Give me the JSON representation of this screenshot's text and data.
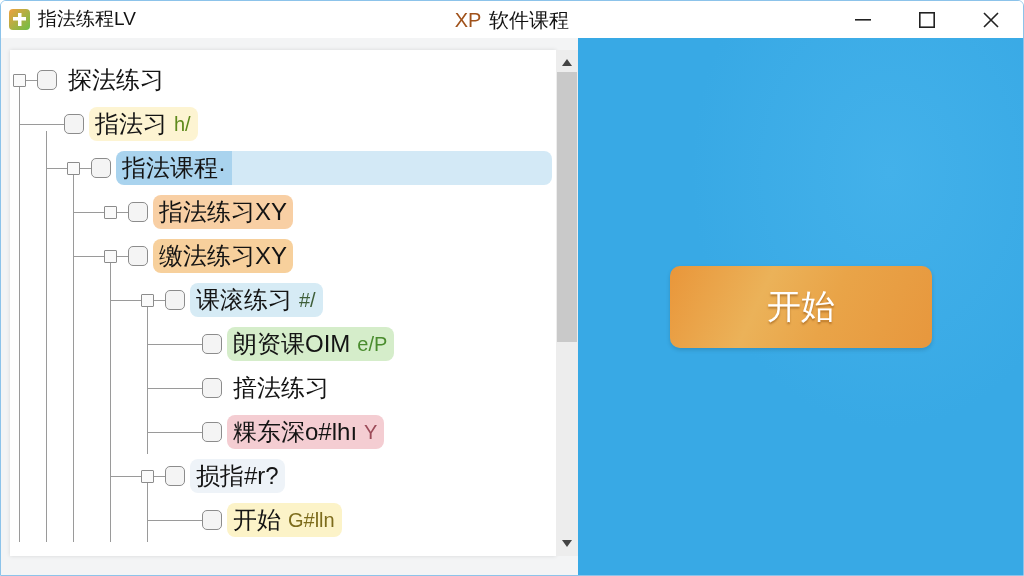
{
  "window": {
    "app_title": "指法练程LV",
    "title_prefix": "XP",
    "title": "软件课程"
  },
  "tree": [
    {
      "kind": "branch",
      "label": "探法练习",
      "checked": false,
      "selected": false,
      "children": [
        {
          "kind": "leaf",
          "label": "指法习",
          "tag": {
            "text": "h/",
            "color": "#5f8a1c"
          },
          "color": "#fdf4d2",
          "checked": false,
          "selected": false,
          "children": [
            {
              "kind": "branch",
              "label": "指法课程·",
              "checked": false,
              "selected": true,
              "children": [
                {
                  "kind": "branch",
                  "label": "指法练习XY",
                  "color": "#f8cfa4",
                  "checked": false,
                  "selected": false
                },
                {
                  "kind": "branch",
                  "label": "缴法练习XY",
                  "color": "#f7d09c",
                  "checked": false,
                  "selected": false,
                  "children": [
                    {
                      "kind": "branch",
                      "label": "课滚练习",
                      "tag": {
                        "text": "#/",
                        "color": "#3f5f3a"
                      },
                      "color": "#d6ebf5",
                      "checked": false,
                      "selected": false,
                      "children": [
                        {
                          "kind": "leaf",
                          "label": "朗资课OIM",
                          "tag": {
                            "text": "e/P",
                            "color": "#4a8c2e"
                          },
                          "color": "#d5edca",
                          "checked": false,
                          "selected": false
                        },
                        {
                          "kind": "leaf",
                          "label": "揞法练习",
                          "checked": false,
                          "selected": false
                        },
                        {
                          "kind": "leaf",
                          "label": "粿东深o#lhı",
                          "tag": {
                            "text": "Y",
                            "color": "#9b4a58"
                          },
                          "color": "#f4cdd2",
                          "checked": false,
                          "selected": false
                        }
                      ]
                    },
                    {
                      "kind": "branch",
                      "label": "损指#r?",
                      "color": "#eef3f8",
                      "checked": false,
                      "selected": false,
                      "children": [
                        {
                          "kind": "leaf",
                          "label": "开始",
                          "tag": {
                            "text": "G#lln",
                            "color": "#7d6c1c"
                          },
                          "color": "#fcf3c8",
                          "checked": false,
                          "selected": false
                        }
                      ]
                    }
                  ]
                }
              ]
            }
          ]
        }
      ]
    }
  ],
  "start_button": {
    "label": "开始"
  }
}
